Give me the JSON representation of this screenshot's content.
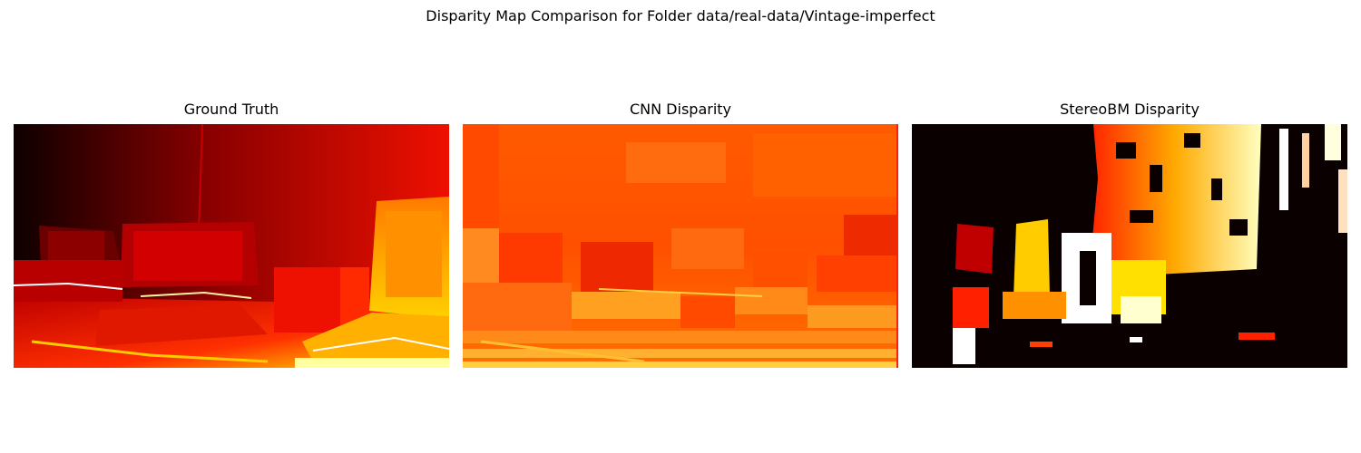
{
  "figure": {
    "suptitle": "Disparity Map Comparison for Folder data/real-data/Vintage-imperfect"
  },
  "chart_data": [
    {
      "type": "heatmap",
      "title": "Ground Truth",
      "colormap": "hot",
      "axes": "off",
      "source": "ground_truth"
    },
    {
      "type": "heatmap",
      "title": "CNN Disparity",
      "colormap": "hot",
      "axes": "off",
      "source": "cnn"
    },
    {
      "type": "heatmap",
      "title": "StereoBM Disparity",
      "colormap": "hot",
      "axes": "off",
      "source": "stereobm"
    }
  ],
  "colors": {
    "black": "#000000",
    "dark_red": "#3a0000",
    "red": "#cc0000",
    "bright_red": "#ff2000",
    "orange": "#ff6a00",
    "yellow": "#ffee00",
    "white": "#ffffff"
  }
}
